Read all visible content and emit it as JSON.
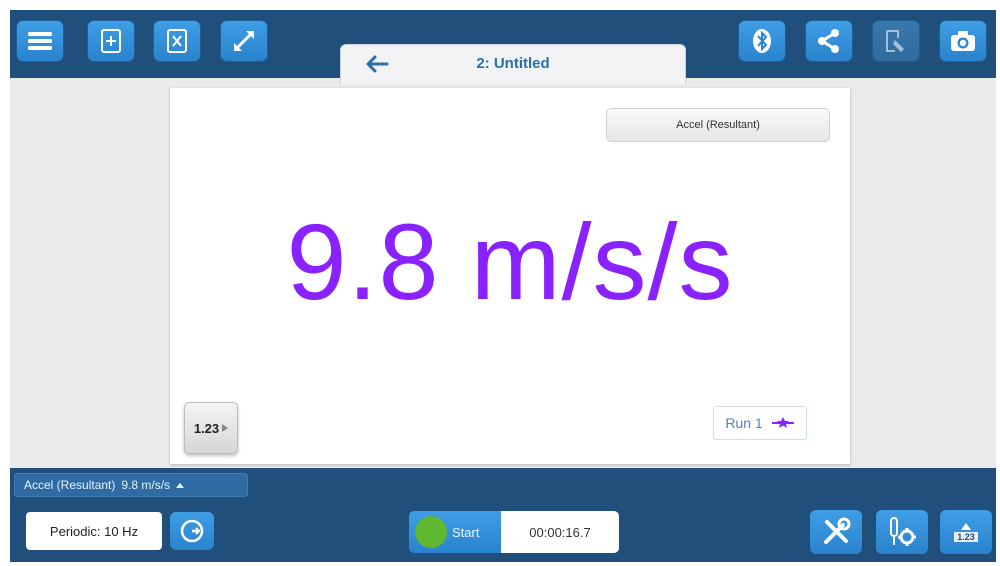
{
  "header": {
    "document_title": "2: Untitled",
    "buttons": [
      {
        "name": "menu",
        "icon": "hamburger-icon"
      },
      {
        "name": "new-file",
        "icon": "file-plus-icon"
      },
      {
        "name": "close-file",
        "icon": "file-x-icon"
      },
      {
        "name": "fullscreen",
        "icon": "expand-arrows-icon"
      },
      {
        "name": "bluetooth",
        "icon": "bluetooth-icon"
      },
      {
        "name": "share",
        "icon": "share-icon"
      },
      {
        "name": "annotate",
        "icon": "page-pen-icon",
        "disabled": true
      },
      {
        "name": "snapshot",
        "icon": "camera-icon"
      }
    ]
  },
  "page": {
    "sensor_selector": "Accel (Resultant)",
    "reading": "9.8 m/s/s",
    "precision": "1.23",
    "run_label": "Run 1"
  },
  "status": {
    "chip_label": "Accel (Resultant)",
    "chip_value": "9.8 m/s/s"
  },
  "footer": {
    "sampling": "Periodic: 10 Hz",
    "start_label": "Start",
    "timer": "00:00:16.7",
    "meter_icon_label": "1.23"
  },
  "colors": {
    "toolbar_bg": "#1f4f7a",
    "button_blue": "#3a95de",
    "reading": "#8a22ff",
    "start_green": "#5fb830"
  }
}
